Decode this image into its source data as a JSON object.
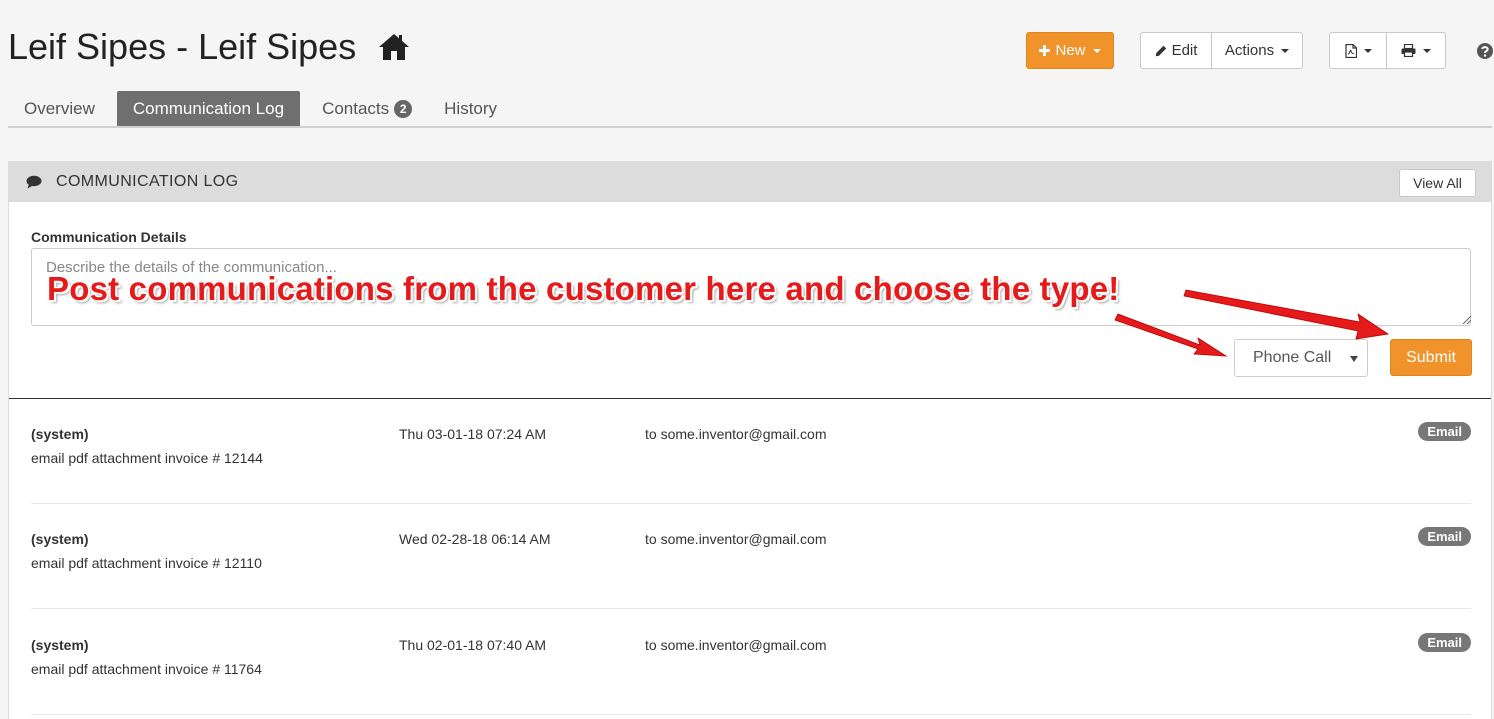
{
  "header": {
    "title": "Leif Sipes - Leif Sipes",
    "new_label": "New",
    "edit_label": "Edit",
    "actions_label": "Actions"
  },
  "tabs": [
    {
      "label": "Overview"
    },
    {
      "label": "Communication Log"
    },
    {
      "label": "Contacts",
      "count": "2"
    },
    {
      "label": "History"
    }
  ],
  "panel": {
    "title": "COMMUNICATION LOG",
    "view_all_label": "View All",
    "field_label": "Communication Details",
    "textarea_placeholder": "Describe the details of the communication...",
    "type_selected": "Phone Call",
    "submit_label": "Submit"
  },
  "log_entries": [
    {
      "author": "(system)",
      "detail": "email pdf attachment invoice # 12144",
      "date": "Thu 03-01-18 07:24 AM",
      "recipient": "to some.inventor@gmail.com",
      "type": "Email"
    },
    {
      "author": "(system)",
      "detail": "email pdf attachment invoice # 12110",
      "date": "Wed 02-28-18 06:14 AM",
      "recipient": "to some.inventor@gmail.com",
      "type": "Email"
    },
    {
      "author": "(system)",
      "detail": "email pdf attachment invoice # 11764",
      "date": "Thu 02-01-18 07:40 AM",
      "recipient": "to some.inventor@gmail.com",
      "type": "Email"
    }
  ],
  "annotation": {
    "text": "Post communications from the customer here and choose the type!"
  },
  "colors": {
    "accent": "#f0932b",
    "tab_active": "#6f6f6f",
    "annotation": "#e51a1a"
  },
  "icons": {
    "title": "home-icon",
    "new": "plus-icon",
    "edit": "pencil-icon",
    "pdf": "pdf-icon",
    "print": "printer-icon",
    "help": "help-icon",
    "panel": "chat-icon"
  }
}
